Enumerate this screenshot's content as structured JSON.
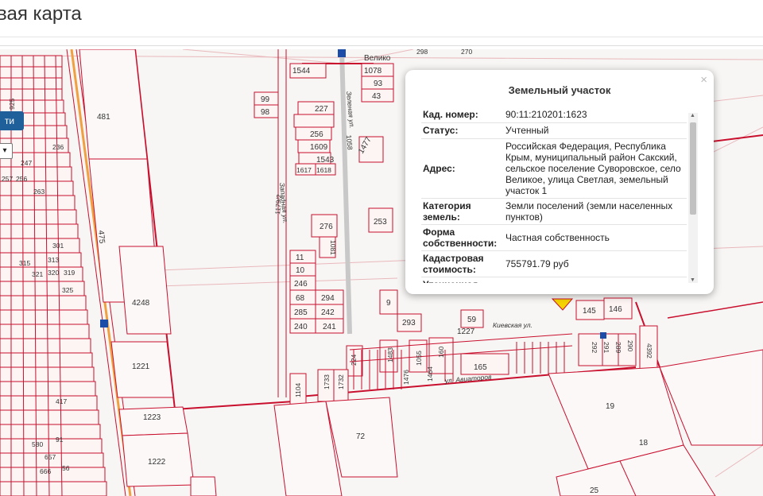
{
  "page": {
    "title": "вая карта"
  },
  "map": {
    "button_label": "ти",
    "select_value": "",
    "place_name": "Велико",
    "streets": [
      "Зеленая ул.",
      "Киевская ул.",
      "ул. Авиаторов",
      "Западная ул."
    ],
    "parcels": [
      {
        "label": "1544"
      },
      {
        "label": "1078"
      },
      {
        "label": "93"
      },
      {
        "label": "43"
      },
      {
        "label": "99"
      },
      {
        "label": "98"
      },
      {
        "label": "227"
      },
      {
        "label": "256"
      },
      {
        "label": "1609"
      },
      {
        "label": "1543"
      },
      {
        "label": "1617"
      },
      {
        "label": "1618"
      },
      {
        "label": "1477"
      },
      {
        "label": "1058"
      },
      {
        "label": "1179/2"
      },
      {
        "label": "481"
      },
      {
        "label": "475"
      },
      {
        "label": "4248"
      },
      {
        "label": "1221"
      },
      {
        "label": "1223"
      },
      {
        "label": "1222"
      },
      {
        "label": "276"
      },
      {
        "label": "1081"
      },
      {
        "label": "253"
      },
      {
        "label": "11"
      },
      {
        "label": "10"
      },
      {
        "label": "246"
      },
      {
        "label": "68"
      },
      {
        "label": "294"
      },
      {
        "label": "285"
      },
      {
        "label": "242"
      },
      {
        "label": "240"
      },
      {
        "label": "241"
      },
      {
        "label": "9"
      },
      {
        "label": "293"
      },
      {
        "label": "59"
      },
      {
        "label": "145"
      },
      {
        "label": "146"
      },
      {
        "label": "1227"
      },
      {
        "label": "224"
      },
      {
        "label": "1483"
      },
      {
        "label": "1476"
      },
      {
        "label": "1055"
      },
      {
        "label": "160"
      },
      {
        "label": "1464"
      },
      {
        "label": "165"
      },
      {
        "label": "1104"
      },
      {
        "label": "1733"
      },
      {
        "label": "1732"
      },
      {
        "label": "292"
      },
      {
        "label": "291"
      },
      {
        "label": "289"
      },
      {
        "label": "290"
      },
      {
        "label": "4392"
      },
      {
        "label": "19"
      },
      {
        "label": "18"
      },
      {
        "label": "25"
      },
      {
        "label": "72"
      },
      {
        "label": "298"
      },
      {
        "label": "270"
      },
      {
        "label": "236"
      },
      {
        "label": "247"
      },
      {
        "label": "257"
      },
      {
        "label": "256"
      },
      {
        "label": "263"
      },
      {
        "label": "301"
      },
      {
        "label": "315"
      },
      {
        "label": "313"
      },
      {
        "label": "321"
      },
      {
        "label": "320"
      },
      {
        "label": "319"
      },
      {
        "label": "325"
      },
      {
        "label": "417"
      },
      {
        "label": "580"
      },
      {
        "label": "91"
      },
      {
        "label": "657"
      },
      {
        "label": "666"
      },
      {
        "label": "56"
      },
      {
        "label": "925"
      }
    ]
  },
  "popup": {
    "title": "Земельный участок",
    "close_glyph": "×",
    "rows": [
      {
        "key": "Кад. номер:",
        "value": "90:11:210201:1623"
      },
      {
        "key": "Статус:",
        "value": "Учтенный"
      },
      {
        "key": "Адрес:",
        "value": "Российская Федерация, Республика Крым, муниципальный район Сакский, сельское поселение Суворовское, село Великое, улица Светлая, земельный участок 1"
      },
      {
        "key": "Категория земель:",
        "value": "Земли поселений (земли населенных пунктов)"
      },
      {
        "key": "Форма собственности:",
        "value": "Частная собственность"
      },
      {
        "key": "Кадастровая стоимость:",
        "value": "755791.79 руб"
      },
      {
        "key": "Уточненная",
        "value": ""
      }
    ]
  },
  "colors": {
    "boundary": "#c8102e",
    "boundary_light": "#e8a0a8",
    "selected_fill": "#f5d300",
    "road": "#f0a040",
    "popup_bg": "#ffffff"
  }
}
